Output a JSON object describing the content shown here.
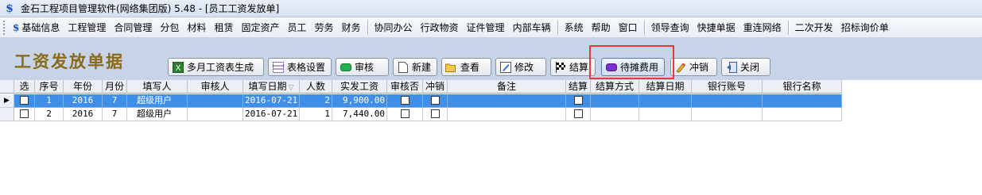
{
  "window": {
    "title": "金石工程项目管理软件(网络集团版) 5.48 - [员工工资发放单]",
    "logo_glyph": "$"
  },
  "menu": {
    "items": [
      "基础信息",
      "工程管理",
      "合同管理",
      "分包",
      "材料",
      "租赁",
      "固定资产",
      "员工",
      "劳务",
      "财务",
      "协同办公",
      "行政物资",
      "证件管理",
      "内部车辆",
      "系统",
      "帮助",
      "窗口",
      "领导查询",
      "快捷单据",
      "重连网络",
      "二次开发",
      "招标询价单"
    ]
  },
  "page": {
    "title": "工资发放单据"
  },
  "toolbar": {
    "generate_monthly": "多月工资表生成",
    "table_settings": "表格设置",
    "audit": "审核",
    "new": "新建",
    "view": "查看",
    "edit": "修改",
    "settle": "结算",
    "pending_expense": "待摊费用",
    "reverse": "冲销",
    "close": "关闭"
  },
  "table": {
    "columns": [
      "选",
      "序号",
      "年份",
      "月份",
      "填写人",
      "审核人",
      "填写日期",
      "人数",
      "实发工资",
      "审核否",
      "冲销",
      "备注",
      "结算",
      "结算方式",
      "结算日期",
      "银行账号",
      "银行名称"
    ],
    "rows": [
      {
        "seq": "1",
        "year": "2016",
        "month": "7",
        "filler": "超级用户",
        "reviewer": "",
        "date": "2016-07-21",
        "count": "2",
        "salary": "9,900.00",
        "note": "",
        "method": "",
        "settle_date": "",
        "bank_account": "",
        "bank_name": ""
      },
      {
        "seq": "2",
        "year": "2016",
        "month": "7",
        "filler": "超级用户",
        "reviewer": "",
        "date": "2016-07-21",
        "count": "1",
        "salary": "7,440.00",
        "note": "",
        "method": "",
        "settle_date": "",
        "bank_account": "",
        "bank_name": ""
      }
    ],
    "selected_row": 0,
    "row_indicator": "▶",
    "sort_indicator": "▽"
  },
  "colors": {
    "selection": "#3f8ee8",
    "title_gold": "#8a6a1a",
    "highlight_red": "#e23b3b",
    "toolbar_bg": "#c7d4e8"
  }
}
